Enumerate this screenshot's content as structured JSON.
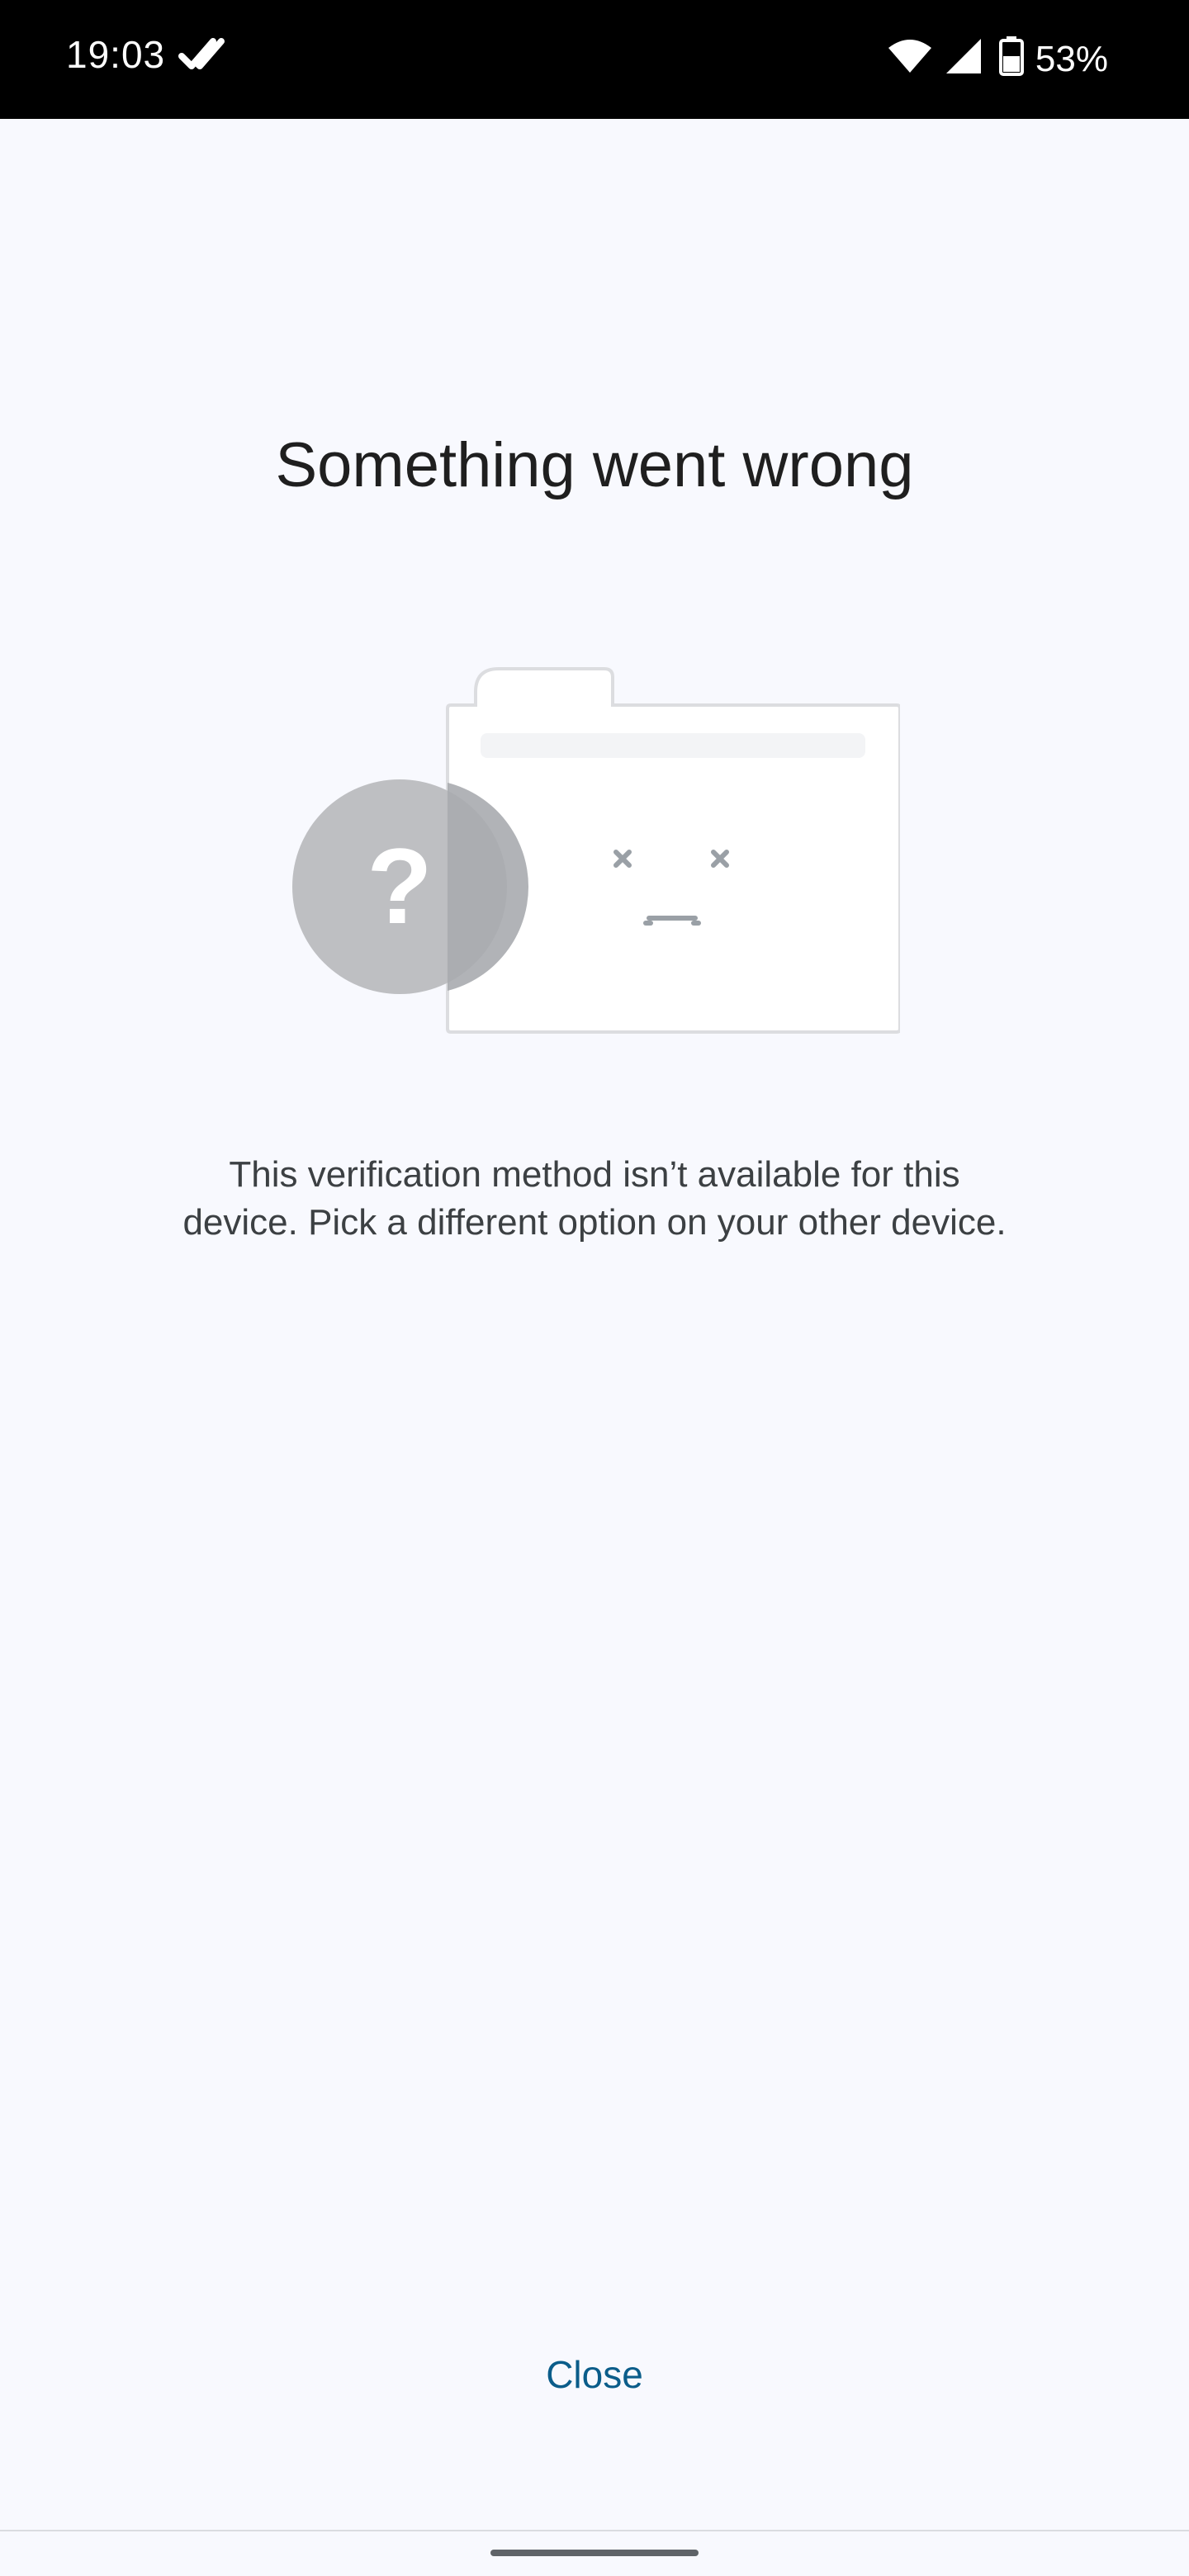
{
  "status_bar": {
    "time": "19:03",
    "battery_percent": "53%",
    "icons": [
      "check-icon",
      "wifi-icon",
      "signal-icon",
      "battery-icon"
    ]
  },
  "error": {
    "title": "Something went wrong",
    "description_line1": "This verification method isn’t available for this",
    "description_line2": "device. Pick a different option on your other device.",
    "illustration_glyph": "?"
  },
  "actions": {
    "close_label": "Close"
  },
  "colors": {
    "background": "#f8f9fe",
    "accent": "#0b5d8a",
    "text_primary": "#1f1f1f",
    "text_secondary": "#3c4043"
  }
}
